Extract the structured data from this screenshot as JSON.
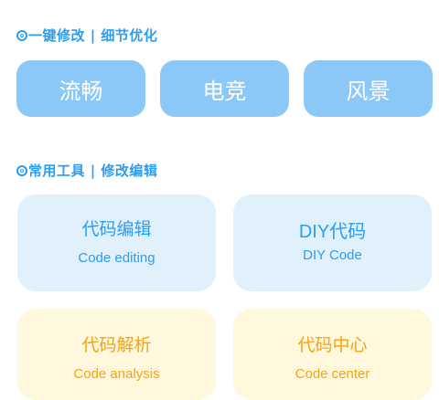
{
  "sections": {
    "quick": {
      "title": "一键修改 | 细节优化"
    },
    "tools": {
      "title": "常用工具 | 修改编辑"
    }
  },
  "modes": [
    {
      "label": "流畅"
    },
    {
      "label": "电竞"
    },
    {
      "label": "风景"
    }
  ],
  "tools": [
    {
      "title": "代码编辑",
      "subtitle": "Code editing",
      "color": "#2a9df4"
    },
    {
      "title": "DIY代码",
      "subtitle": "DIY Code",
      "color": "#2a9df4"
    },
    {
      "title": "代码解析",
      "subtitle": "Code analysis",
      "color": "#f5a312"
    },
    {
      "title": "代码中心",
      "subtitle": "Code center",
      "color": "#f5a312"
    }
  ],
  "colors": {
    "accent": "#2a9df4",
    "mode_button_bg": "#8cc8f7",
    "blue_card_bg": "#e1f1fc",
    "yellow_card_bg": "#fff8dc",
    "yellow_text": "#f5a312"
  },
  "icons": {
    "section_marker": "circle-bullet-icon"
  }
}
